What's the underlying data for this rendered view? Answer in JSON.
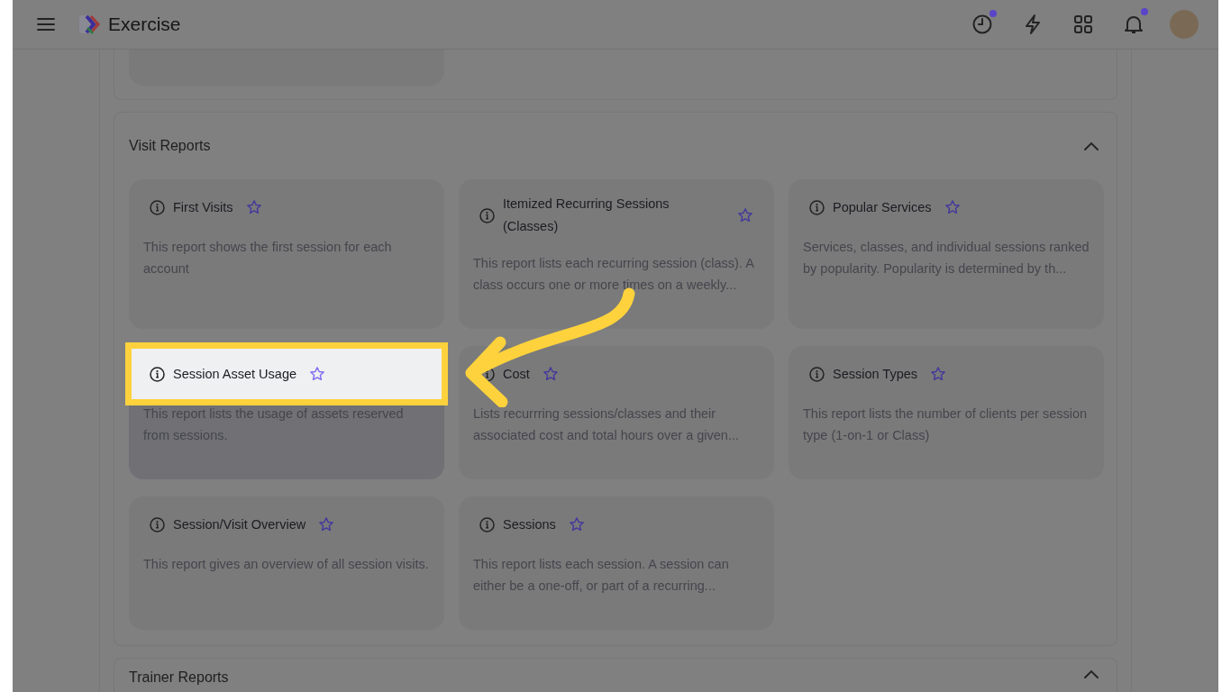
{
  "header": {
    "app_name": "Exercise",
    "history_badge": true,
    "notifications_badge": true
  },
  "sections": [
    {
      "title": "Visit Reports",
      "expanded": true,
      "cards": [
        {
          "title": "First Visits",
          "description": "This report shows the first session for each account",
          "highlighted": false
        },
        {
          "title": "Itemized Recurring Sessions (Classes)",
          "description": "This report lists each recurring session (class). A class occurs one or more times on a weekly...",
          "highlighted": false
        },
        {
          "title": "Popular Services",
          "description": "Services, classes, and individual sessions ranked by popularity. Popularity is determined by th...",
          "highlighted": false
        },
        {
          "title": "Session Asset Usage",
          "description": "This report lists the usage of assets reserved from sessions.",
          "highlighted": true
        },
        {
          "title": "Cost",
          "description": "Lists recurrring sessions/classes and their associated cost and total hours over a given...",
          "highlighted": false
        },
        {
          "title": "Session Types",
          "description": "This report lists the number of clients per session type (1-on-1 or Class)",
          "highlighted": false
        },
        {
          "title": "Session/Visit Overview",
          "description": "This report gives an overview of all session visits.",
          "highlighted": false
        },
        {
          "title": "Sessions",
          "description": "This report lists each session. A session can either be a one-off, or part of a recurring...",
          "highlighted": false
        }
      ]
    },
    {
      "title": "Trainer Reports",
      "expanded": true
    }
  ]
}
